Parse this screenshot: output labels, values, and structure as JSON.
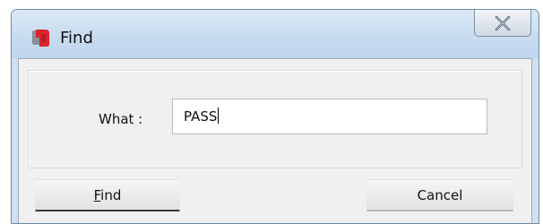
{
  "window": {
    "title": "Find",
    "close_icon": "close-x-icon",
    "app_icon": "find-app-icon"
  },
  "form": {
    "what_label": "What :",
    "what_value": "PASS"
  },
  "buttons": {
    "find_label": "Find",
    "find_mnemonic": "F",
    "cancel_label": "Cancel"
  },
  "colors": {
    "titlebar": "#c8dcf0",
    "client_background": "#f0f0f0",
    "app_icon_red": "#d8262b",
    "app_icon_gray": "#8a8f98"
  }
}
